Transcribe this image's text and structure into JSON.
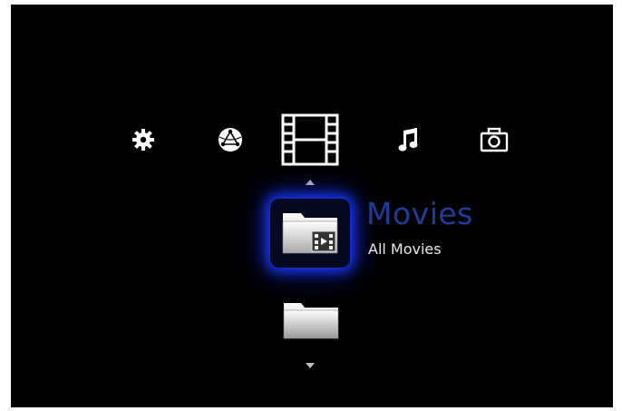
{
  "top_menu": {
    "items": [
      {
        "icon": "gear-icon",
        "label": "Settings"
      },
      {
        "icon": "internet-globe-icon",
        "label": "Internet"
      },
      {
        "icon": "film-strip-icon",
        "label": "Video"
      },
      {
        "icon": "music-note-icon",
        "label": "Music"
      },
      {
        "icon": "camera-icon",
        "label": "Photo"
      }
    ],
    "selected_index": 2
  },
  "list": {
    "selected": {
      "icon": "movies-folder-icon",
      "title": "Movies",
      "subtitle": "All Movies"
    },
    "next": {
      "icon": "folder-icon"
    }
  },
  "colors": {
    "background": "#000000",
    "title": "#1c3d9a",
    "subtitle": "#e8e8e8",
    "glow": "#1a3bff"
  }
}
